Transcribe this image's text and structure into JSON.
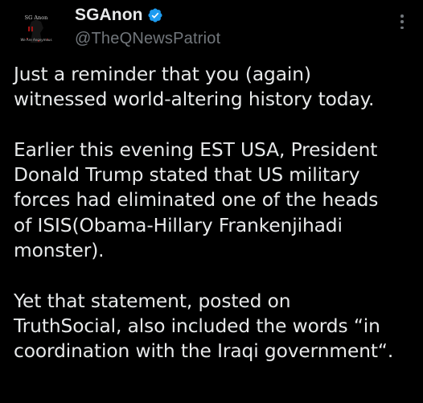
{
  "post": {
    "author": {
      "display_name": "SGAnon",
      "handle": "@TheQNewsPatriot",
      "verified": true,
      "badge_color": "#1d9bf0",
      "avatar": {
        "label_top": "SG Anon",
        "label_bottom": "We Are Anonymous"
      }
    },
    "more_icon": "more-vertical-icon",
    "paragraphs": [
      "Just a reminder that you (again)\nwitnessed world-altering history today.",
      "Earlier this evening EST USA, President\nDonald Trump stated that US military\nforces had eliminated one of the heads\nof ISIS(Obama-Hillary Frankenjihadi\nmonster).",
      "Yet that statement, posted on\nTruthSocial, also included the words “in\ncoordination with the Iraqi government“."
    ]
  },
  "colors": {
    "background": "#000000",
    "primary_text": "#e7e9ea",
    "secondary_text": "#71767b",
    "accent": "#1d9bf0"
  }
}
